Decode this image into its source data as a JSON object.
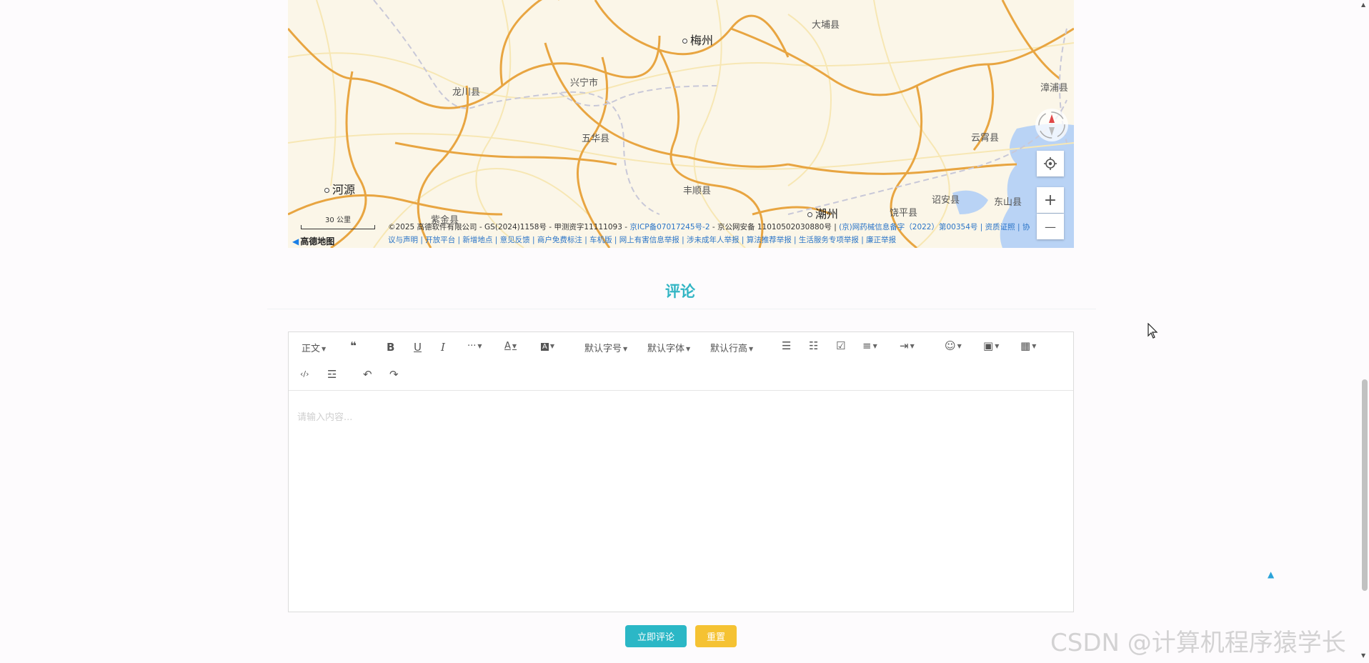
{
  "map": {
    "cities": [
      {
        "name": "梅州",
        "major": true
      },
      {
        "name": "大埔县",
        "major": false
      },
      {
        "name": "兴宁市",
        "major": false
      },
      {
        "name": "龙川县",
        "major": false
      },
      {
        "name": "五华县",
        "major": false
      },
      {
        "name": "云霄县",
        "major": false
      },
      {
        "name": "漳浦县",
        "major": false
      },
      {
        "name": "河源",
        "major": true
      },
      {
        "name": "丰顺县",
        "major": false
      },
      {
        "name": "潮州",
        "major": true
      },
      {
        "name": "饶平县",
        "major": false
      },
      {
        "name": "诏安县",
        "major": false
      },
      {
        "name": "东山县",
        "major": false
      },
      {
        "name": "紫金县",
        "major": false
      }
    ],
    "scale_label": "30 公里",
    "logo_text": "高德地图",
    "copyright_line1": "©2025 高德软件有限公司 - GS(2024)1158号 - 甲测资字11111093 - ",
    "copyright_link1": "京ICP备07017245号-2",
    "copyright_mid": " - 京公网安备 11010502030880号 | ",
    "copyright_link2": "(京)网药械信息备字（2022）第00354号 | 资质证照 | 协",
    "copyright_line2": "议与声明 | 开放平台 | 新增地点 | 意见反馈 | 商户免费标注 | 车机版 | 网上有害信息举报 | 涉未成年人举报 | 算法推荐举报 | 生活服务专项举报 | 廉正举报",
    "controls": {
      "locate_icon": "locate-icon",
      "zoom_in": "+",
      "zoom_out": "—"
    }
  },
  "comment": {
    "title": "评论",
    "placeholder": "请输入内容...",
    "toolbar": {
      "paragraph": "正文",
      "font_size": "默认字号",
      "font_family": "默认字体",
      "line_height": "默认行高",
      "bold": "B",
      "underline": "U",
      "italic": "I",
      "more": "···",
      "font_color": "A",
      "bg_color": "A"
    },
    "submit_label": "立即评论",
    "reset_label": "重置"
  },
  "colors": {
    "accent": "#2bb7c6",
    "reset": "#f5c233",
    "title": "#32b5c4"
  },
  "watermark": "CSDN @计算机程序猿学长"
}
